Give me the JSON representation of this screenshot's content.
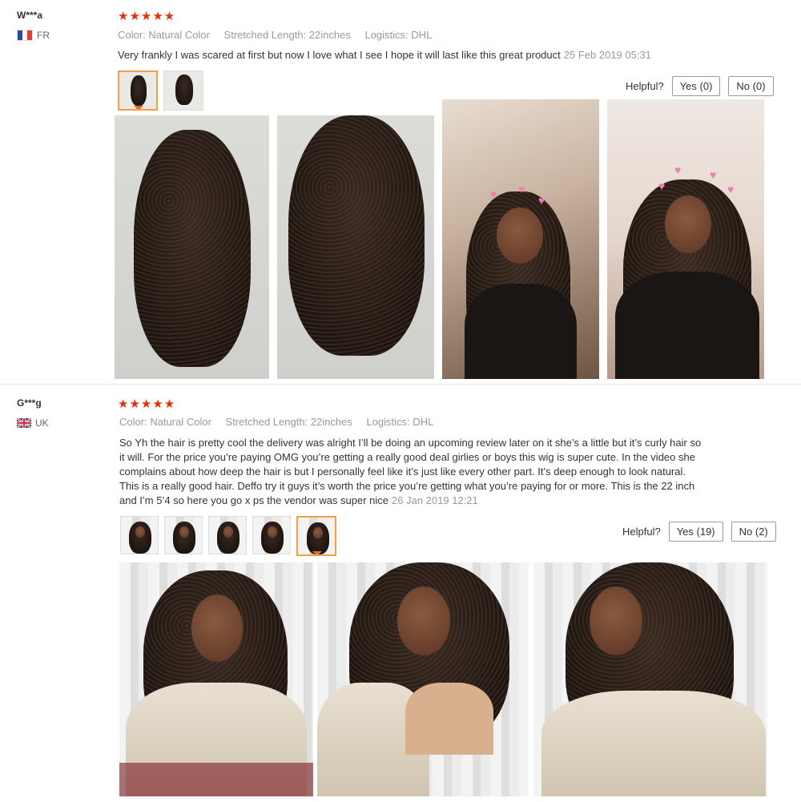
{
  "reviews": [
    {
      "user": "W***a",
      "country": "FR",
      "stars": "★★★★★",
      "attributes": [
        {
          "key": "Color:",
          "value": "Natural Color"
        },
        {
          "key": "Stretched Length:",
          "value": "22inches"
        },
        {
          "key": "Logistics:",
          "value": "DHL"
        }
      ],
      "text": "Very frankly I was scared at first but now I love what I see I hope it will last like this great product",
      "date": "25 Feb 2019 05:31",
      "helpful_label": "Helpful?",
      "yes_label": "Yes (0)",
      "no_label": "No (0)"
    },
    {
      "user": "G***g",
      "country": "UK",
      "stars": "★★★★★",
      "attributes": [
        {
          "key": "Color:",
          "value": "Natural Color"
        },
        {
          "key": "Stretched Length:",
          "value": "22inches"
        },
        {
          "key": "Logistics:",
          "value": "DHL"
        }
      ],
      "text": "So Yh the hair is pretty cool the delivery was alright I’ll be doing an upcoming review later on it she’s a little but it’s curly hair so it will. For the price you’re paying OMG you’re getting a really good deal girlies or boys this wig is super cute. In the video she complains about how deep the hair is but I personally feel like it’s just like every other part. It’s deep enough to look natural. This is a really good hair. Deffo try it guys it’s worth the price you’re getting what you’re paying for or more. This is the 22 inch and I’m 5’4 so here you go x ps the vendor was super nice",
      "date": "26 Jan 2019 12:21",
      "helpful_label": "Helpful?",
      "yes_label": "Yes (19)",
      "no_label": "No (2)"
    }
  ]
}
